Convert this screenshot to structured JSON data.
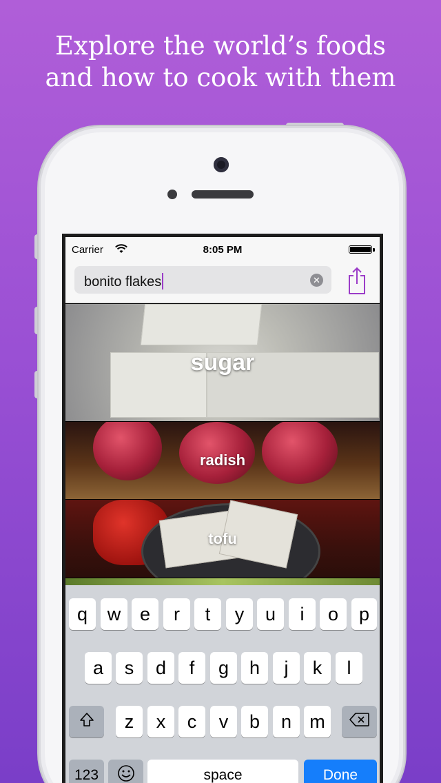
{
  "headline": {
    "line1": "Explore the world’s foods",
    "line2": "and how to cook with them"
  },
  "status_bar": {
    "carrier": "Carrier",
    "time": "8:05 PM",
    "wifi_icon": "wifi-icon",
    "battery_level": 1.0
  },
  "search": {
    "value": "bonito flakes",
    "clear_icon": "clear-icon"
  },
  "toolbar": {
    "share_icon": "share-icon",
    "accent_color": "#9b3cc8"
  },
  "foods": [
    {
      "name": "sugar"
    },
    {
      "name": "radish"
    },
    {
      "name": "tofu"
    }
  ],
  "keyboard": {
    "row1": [
      "q",
      "w",
      "e",
      "r",
      "t",
      "y",
      "u",
      "i",
      "o",
      "p"
    ],
    "row2": [
      "a",
      "s",
      "d",
      "f",
      "g",
      "h",
      "j",
      "k",
      "l"
    ],
    "row3": [
      "z",
      "x",
      "c",
      "v",
      "b",
      "n",
      "m"
    ],
    "shift_icon": "shift-icon",
    "backspace_icon": "backspace-icon",
    "numbers_label": "123",
    "emoji_icon": "emoji-icon",
    "space_label": "space",
    "done_label": "Done",
    "done_color": "#157efb"
  }
}
